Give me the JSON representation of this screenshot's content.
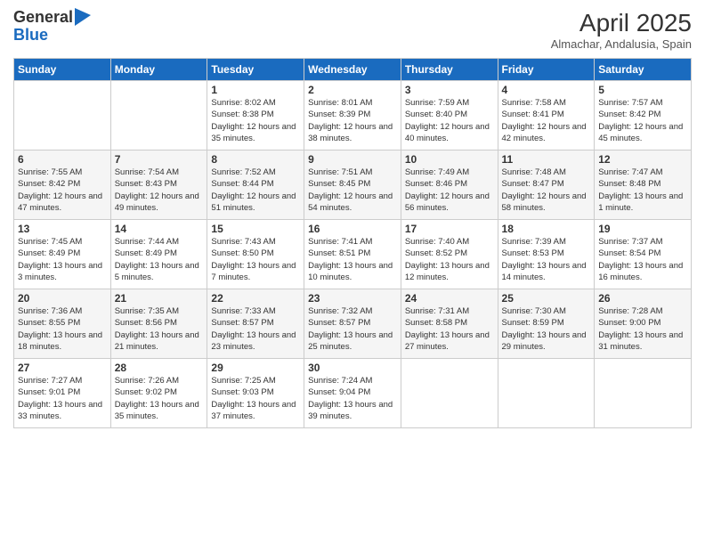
{
  "logo": {
    "general": "General",
    "blue": "Blue"
  },
  "title": "April 2025",
  "subtitle": "Almachar, Andalusia, Spain",
  "days_header": [
    "Sunday",
    "Monday",
    "Tuesday",
    "Wednesday",
    "Thursday",
    "Friday",
    "Saturday"
  ],
  "weeks": [
    [
      {
        "day": "",
        "info": ""
      },
      {
        "day": "",
        "info": ""
      },
      {
        "day": "1",
        "info": "Sunrise: 8:02 AM\nSunset: 8:38 PM\nDaylight: 12 hours and 35 minutes."
      },
      {
        "day": "2",
        "info": "Sunrise: 8:01 AM\nSunset: 8:39 PM\nDaylight: 12 hours and 38 minutes."
      },
      {
        "day": "3",
        "info": "Sunrise: 7:59 AM\nSunset: 8:40 PM\nDaylight: 12 hours and 40 minutes."
      },
      {
        "day": "4",
        "info": "Sunrise: 7:58 AM\nSunset: 8:41 PM\nDaylight: 12 hours and 42 minutes."
      },
      {
        "day": "5",
        "info": "Sunrise: 7:57 AM\nSunset: 8:42 PM\nDaylight: 12 hours and 45 minutes."
      }
    ],
    [
      {
        "day": "6",
        "info": "Sunrise: 7:55 AM\nSunset: 8:42 PM\nDaylight: 12 hours and 47 minutes."
      },
      {
        "day": "7",
        "info": "Sunrise: 7:54 AM\nSunset: 8:43 PM\nDaylight: 12 hours and 49 minutes."
      },
      {
        "day": "8",
        "info": "Sunrise: 7:52 AM\nSunset: 8:44 PM\nDaylight: 12 hours and 51 minutes."
      },
      {
        "day": "9",
        "info": "Sunrise: 7:51 AM\nSunset: 8:45 PM\nDaylight: 12 hours and 54 minutes."
      },
      {
        "day": "10",
        "info": "Sunrise: 7:49 AM\nSunset: 8:46 PM\nDaylight: 12 hours and 56 minutes."
      },
      {
        "day": "11",
        "info": "Sunrise: 7:48 AM\nSunset: 8:47 PM\nDaylight: 12 hours and 58 minutes."
      },
      {
        "day": "12",
        "info": "Sunrise: 7:47 AM\nSunset: 8:48 PM\nDaylight: 13 hours and 1 minute."
      }
    ],
    [
      {
        "day": "13",
        "info": "Sunrise: 7:45 AM\nSunset: 8:49 PM\nDaylight: 13 hours and 3 minutes."
      },
      {
        "day": "14",
        "info": "Sunrise: 7:44 AM\nSunset: 8:49 PM\nDaylight: 13 hours and 5 minutes."
      },
      {
        "day": "15",
        "info": "Sunrise: 7:43 AM\nSunset: 8:50 PM\nDaylight: 13 hours and 7 minutes."
      },
      {
        "day": "16",
        "info": "Sunrise: 7:41 AM\nSunset: 8:51 PM\nDaylight: 13 hours and 10 minutes."
      },
      {
        "day": "17",
        "info": "Sunrise: 7:40 AM\nSunset: 8:52 PM\nDaylight: 13 hours and 12 minutes."
      },
      {
        "day": "18",
        "info": "Sunrise: 7:39 AM\nSunset: 8:53 PM\nDaylight: 13 hours and 14 minutes."
      },
      {
        "day": "19",
        "info": "Sunrise: 7:37 AM\nSunset: 8:54 PM\nDaylight: 13 hours and 16 minutes."
      }
    ],
    [
      {
        "day": "20",
        "info": "Sunrise: 7:36 AM\nSunset: 8:55 PM\nDaylight: 13 hours and 18 minutes."
      },
      {
        "day": "21",
        "info": "Sunrise: 7:35 AM\nSunset: 8:56 PM\nDaylight: 13 hours and 21 minutes."
      },
      {
        "day": "22",
        "info": "Sunrise: 7:33 AM\nSunset: 8:57 PM\nDaylight: 13 hours and 23 minutes."
      },
      {
        "day": "23",
        "info": "Sunrise: 7:32 AM\nSunset: 8:57 PM\nDaylight: 13 hours and 25 minutes."
      },
      {
        "day": "24",
        "info": "Sunrise: 7:31 AM\nSunset: 8:58 PM\nDaylight: 13 hours and 27 minutes."
      },
      {
        "day": "25",
        "info": "Sunrise: 7:30 AM\nSunset: 8:59 PM\nDaylight: 13 hours and 29 minutes."
      },
      {
        "day": "26",
        "info": "Sunrise: 7:28 AM\nSunset: 9:00 PM\nDaylight: 13 hours and 31 minutes."
      }
    ],
    [
      {
        "day": "27",
        "info": "Sunrise: 7:27 AM\nSunset: 9:01 PM\nDaylight: 13 hours and 33 minutes."
      },
      {
        "day": "28",
        "info": "Sunrise: 7:26 AM\nSunset: 9:02 PM\nDaylight: 13 hours and 35 minutes."
      },
      {
        "day": "29",
        "info": "Sunrise: 7:25 AM\nSunset: 9:03 PM\nDaylight: 13 hours and 37 minutes."
      },
      {
        "day": "30",
        "info": "Sunrise: 7:24 AM\nSunset: 9:04 PM\nDaylight: 13 hours and 39 minutes."
      },
      {
        "day": "",
        "info": ""
      },
      {
        "day": "",
        "info": ""
      },
      {
        "day": "",
        "info": ""
      }
    ]
  ]
}
